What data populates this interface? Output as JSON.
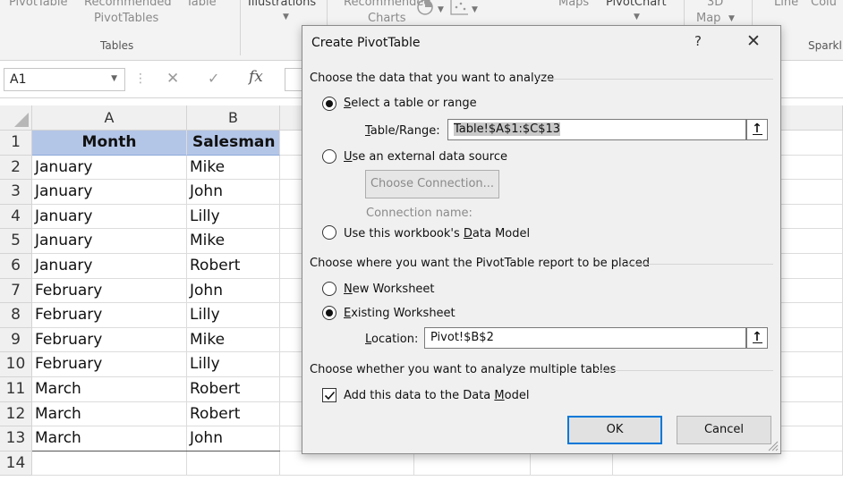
{
  "ribbon": {
    "pivottable": "PivotTable",
    "recommended_pivottables_1": "Recommended",
    "recommended_pivottables_2": "PivotTables",
    "table": "Table",
    "illustrations": "Illustrations",
    "recommended_charts_1": "Recommended",
    "recommended_charts_2": "Charts",
    "maps": "Maps",
    "pivotchart": "PivotChart",
    "map3d_1": "3D",
    "map3d_2": "Map",
    "line": "Line",
    "column": "Colu",
    "group_tables": "Tables",
    "group_sparklines": "Sparkl"
  },
  "formula_bar": {
    "name_box": "A1",
    "fx": "fx"
  },
  "sheet": {
    "columns": [
      "A",
      "B"
    ],
    "rows": [
      "1",
      "2",
      "3",
      "4",
      "5",
      "6",
      "7",
      "8",
      "9",
      "10",
      "11",
      "12",
      "13",
      "14"
    ],
    "headers": [
      "Month",
      "Salesman"
    ],
    "data": [
      [
        "January",
        "Mike"
      ],
      [
        "January",
        "John"
      ],
      [
        "January",
        "Lilly"
      ],
      [
        "January",
        "Mike"
      ],
      [
        "January",
        "Robert"
      ],
      [
        "February",
        "John"
      ],
      [
        "February",
        "Lilly"
      ],
      [
        "February",
        "Mike"
      ],
      [
        "February",
        "Lilly"
      ],
      [
        "March",
        "Robert"
      ],
      [
        "March",
        "Robert"
      ],
      [
        "March",
        "John"
      ]
    ]
  },
  "dialog": {
    "title": "Create PivotTable",
    "help": "?",
    "close": "✕",
    "section_data": "Choose the data that you want to analyze",
    "opt_table_range_pre": "",
    "opt_table_range_u": "S",
    "opt_table_range_post": "elect a table or range",
    "table_range_label_u": "T",
    "table_range_label_post": "able/Range:",
    "table_range_value": "Table!$A$1:$C$13",
    "opt_external_u": "U",
    "opt_external_post": "se an external data source",
    "choose_connection": "Choose Connection...",
    "connection_name": "Connection name:",
    "opt_datamodel_pre": "Use this workbook's ",
    "opt_datamodel_u": "D",
    "opt_datamodel_post": "ata Model",
    "section_place": "Choose where you want the PivotTable report to be placed",
    "opt_new_u": "N",
    "opt_new_post": "ew Worksheet",
    "opt_existing_u": "E",
    "opt_existing_post": "xisting Worksheet",
    "location_label_u": "L",
    "location_label_post": "ocation:",
    "location_value": "Pivot!$B$2",
    "section_multi": "Choose whether you want to analyze multiple tables",
    "add_datamodel_pre": "Add this data to the Data ",
    "add_datamodel_u": "M",
    "add_datamodel_post": "odel",
    "ok": "OK",
    "cancel": "Cancel"
  }
}
